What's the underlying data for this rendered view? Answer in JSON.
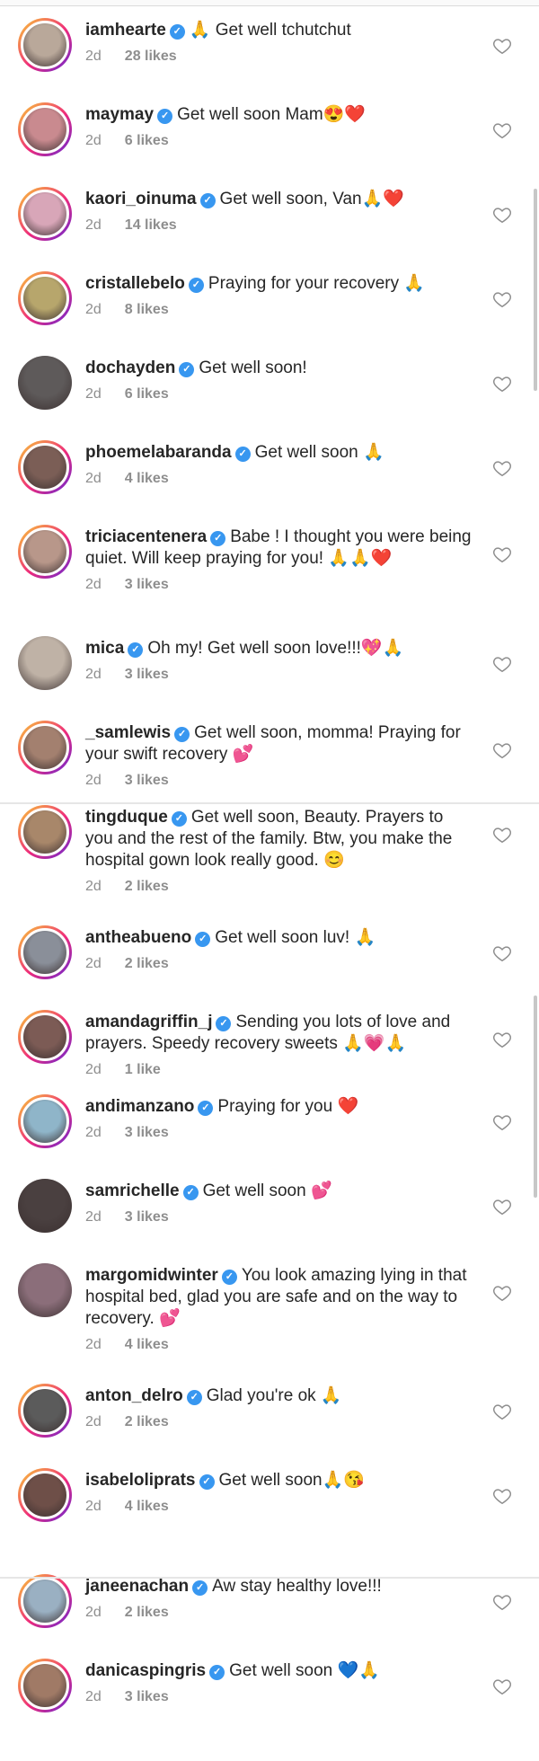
{
  "comments": [
    {
      "username": "iamhearte",
      "text": "🙏 Get well tchutchut",
      "time": "2d",
      "likes": "28 likes",
      "avatar_color": "#b9a89a"
    },
    {
      "username": "maymay",
      "text": "Get well soon Mam😍❤️",
      "time": "2d",
      "likes": "6 likes",
      "avatar_color": "#c98a8f"
    },
    {
      "username": "kaori_oinuma",
      "text": "Get well soon, Van🙏❤️",
      "time": "2d",
      "likes": "14 likes",
      "avatar_color": "#d8a6b8"
    },
    {
      "username": "cristallebelo",
      "text": "Praying for your recovery 🙏",
      "time": "2d",
      "likes": "8 likes",
      "avatar_color": "#b7a66c"
    },
    {
      "username": "dochayden",
      "text": "Get well soon!",
      "time": "2d",
      "likes": "6 likes",
      "avatar_color": "#5e5a5a"
    },
    {
      "username": "phoemelabaranda",
      "text": "Get well soon 🙏",
      "time": "2d",
      "likes": "4 likes",
      "avatar_color": "#7b5e56"
    },
    {
      "username": "triciacentenera",
      "text": "Babe ! I thought you were being quiet. Will keep praying for you! 🙏🙏❤️",
      "time": "2d",
      "likes": "3 likes",
      "avatar_color": "#b8978a"
    },
    {
      "username": "mica",
      "text": "Oh my! Get well soon love!!!💖🙏",
      "time": "2d",
      "likes": "3 likes",
      "avatar_color": "#bfb2a6"
    },
    {
      "username": "_samlewis",
      "text": "Get well soon, momma! Praying for your swift recovery 💕",
      "time": "2d",
      "likes": "3 likes",
      "avatar_color": "#a3806f"
    },
    {
      "username": "tingduque",
      "text": "Get well soon, Beauty. Prayers to you and the rest of the family. Btw, you make the hospital gown look really good. 😊",
      "time": "2d",
      "likes": "2 likes",
      "avatar_color": "#a8876a"
    },
    {
      "username": "antheabueno",
      "text": "Get well soon luv! 🙏",
      "time": "2d",
      "likes": "2 likes",
      "avatar_color": "#8a8f99"
    },
    {
      "username": "amandagriffin_j",
      "text": "Sending you lots of love and prayers. Speedy recovery sweets 🙏💗🙏",
      "time": "2d",
      "likes": "1 like",
      "avatar_color": "#7c5b55"
    },
    {
      "username": "andimanzano",
      "text": "Praying for you ❤️",
      "time": "2d",
      "likes": "3 likes",
      "avatar_color": "#8fb5c9"
    },
    {
      "username": "samrichelle",
      "text": "Get well soon 💕",
      "time": "2d",
      "likes": "3 likes",
      "avatar_color": "#4a4040"
    },
    {
      "username": "margomidwinter",
      "text": "You look amazing lying in that hospital bed, glad you are safe and on the way to recovery. 💕",
      "time": "2d",
      "likes": "4 likes",
      "avatar_color": "#8b6e7a"
    },
    {
      "username": "anton_delro",
      "text": "Glad you're ok 🙏",
      "time": "2d",
      "likes": "2 likes",
      "avatar_color": "#5b5b5b"
    },
    {
      "username": "isabeloliprats",
      "text": "Get well soon🙏😘",
      "time": "2d",
      "likes": "4 likes",
      "avatar_color": "#6e4f48"
    },
    {
      "username": "janeenachan",
      "text": "Aw stay healthy love!!!",
      "time": "2d",
      "likes": "2 likes",
      "avatar_color": "#9ab0c2"
    },
    {
      "username": "danicaspingris",
      "text": "Get well soon 💙🙏",
      "time": "2d",
      "likes": "3 likes",
      "avatar_color": "#a07a66"
    }
  ],
  "icons": {
    "verified": "verified-badge-icon",
    "like": "heart-outline-icon"
  },
  "colors": {
    "verified": "#3897f0",
    "meta": "#8e8e8e",
    "ring_start": "#f9ce34",
    "ring_mid": "#ee2a7b",
    "ring_end": "#6228d7"
  }
}
